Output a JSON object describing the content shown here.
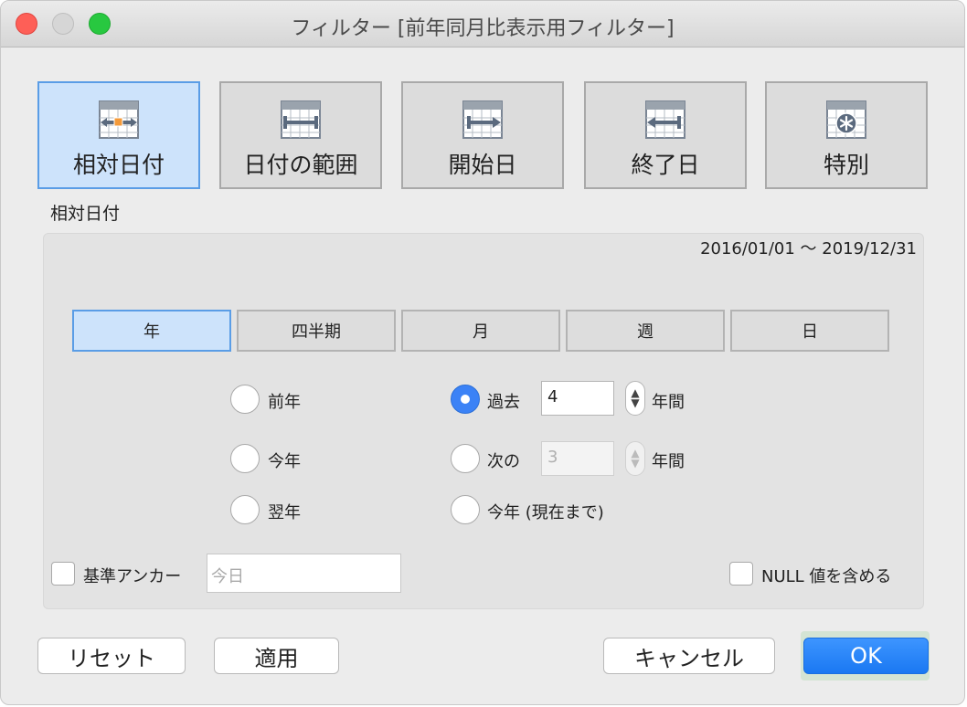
{
  "window": {
    "title": "フィルター [前年同月比表示用フィルター]"
  },
  "modes": [
    {
      "label": "相対日付",
      "icon": "calendar-relative-icon"
    },
    {
      "label": "日付の範囲",
      "icon": "calendar-range-icon"
    },
    {
      "label": "開始日",
      "icon": "calendar-start-icon"
    },
    {
      "label": "終了日",
      "icon": "calendar-end-icon"
    },
    {
      "label": "特別",
      "icon": "calendar-special-icon"
    }
  ],
  "selected_mode": "相対日付",
  "section_label": "相対日付",
  "range_text": "2016/01/01 〜 2019/12/31",
  "units": [
    "年",
    "四半期",
    "月",
    "週",
    "日"
  ],
  "selected_unit": "年",
  "options": {
    "previous": "前年",
    "current": "今年",
    "next": "翌年",
    "last_label": "過去",
    "last_value": "4",
    "next_n_label": "次の",
    "next_n_value": "3",
    "period_unit": "年間",
    "to_date": "今年 (現在まで)"
  },
  "selected_option": "過去",
  "anchor": {
    "label": "基準アンカー",
    "placeholder": "今日",
    "checked": false
  },
  "include_null": {
    "label": "NULL 値を含める",
    "checked": false
  },
  "buttons": {
    "reset": "リセット",
    "apply": "適用",
    "cancel": "キャンセル",
    "ok": "OK"
  },
  "colors": {
    "accent": "#3b82f6",
    "selected_fill": "#cde3fb",
    "selected_border": "#5a9de6"
  }
}
